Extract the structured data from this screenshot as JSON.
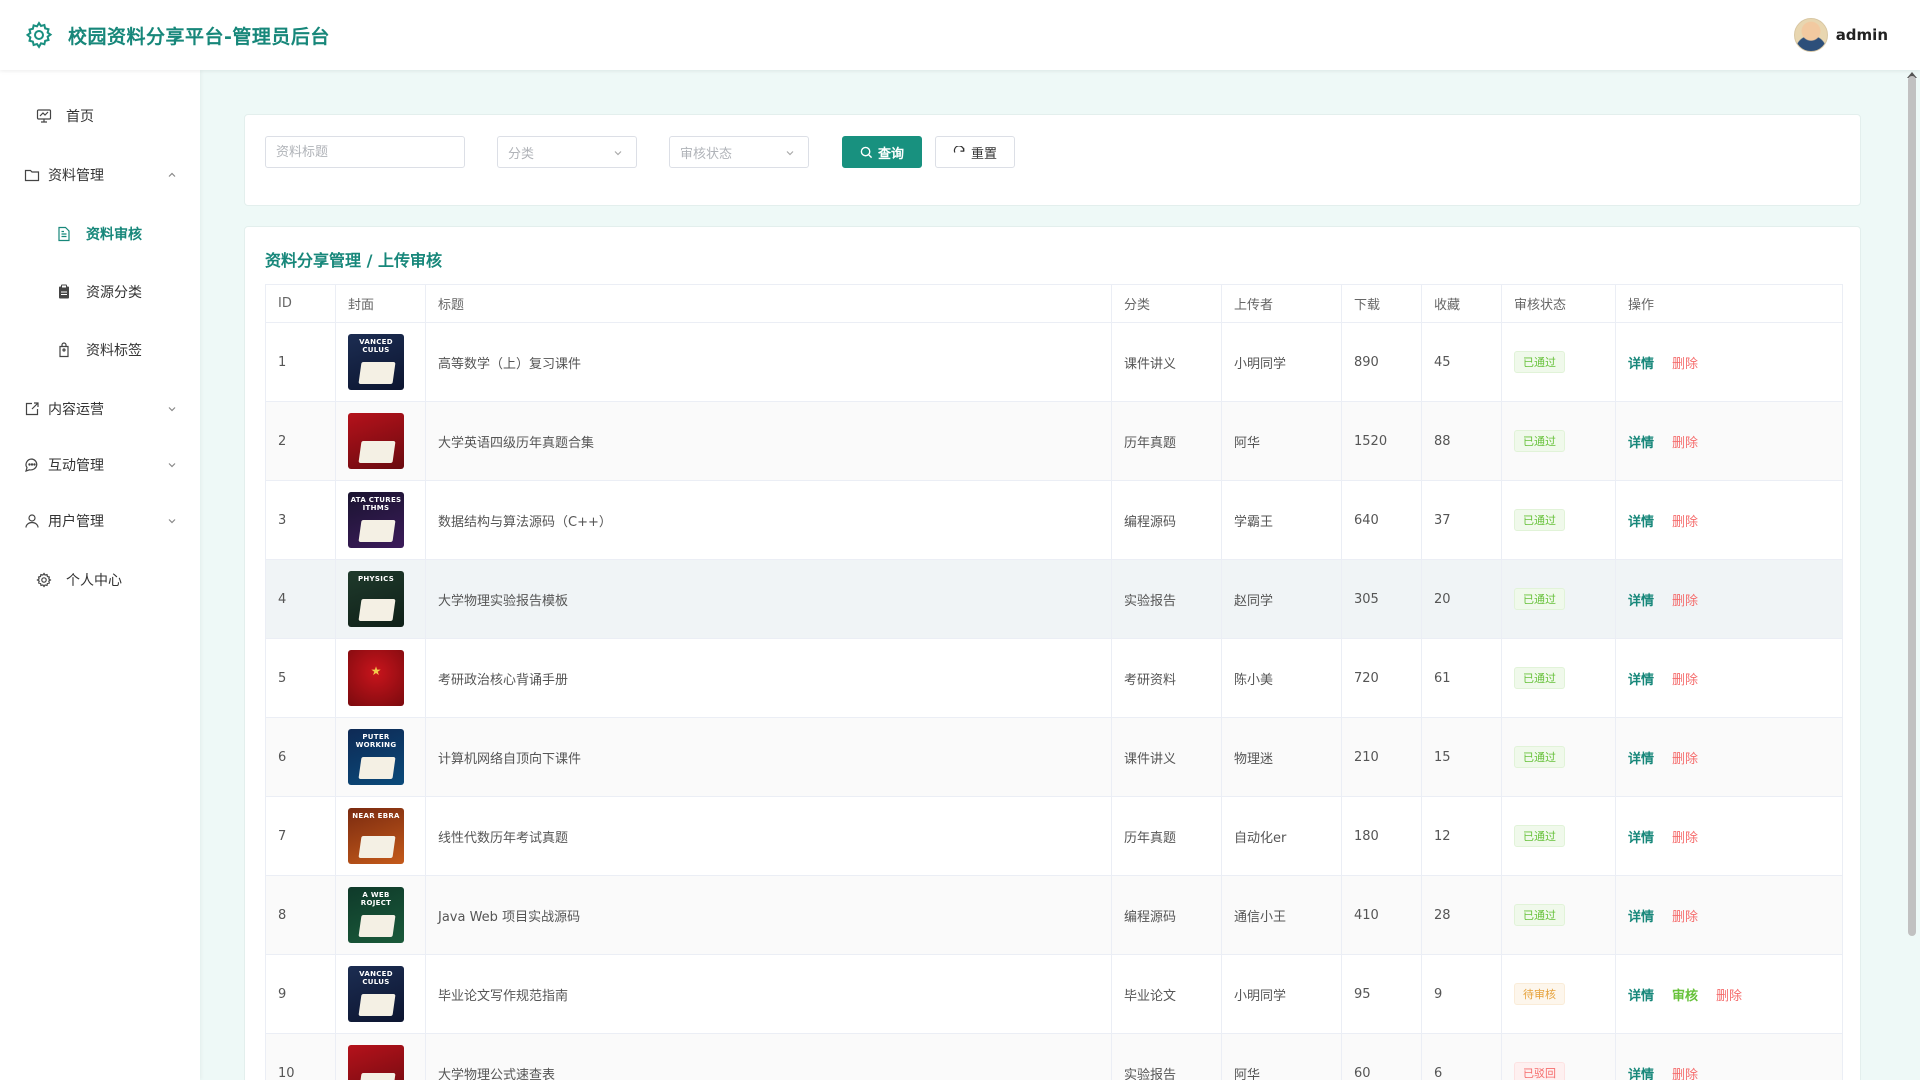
{
  "header": {
    "title": "校园资料分享平台-管理员后台",
    "username": "admin"
  },
  "sidebar": {
    "items": [
      {
        "label": "首页",
        "icon": "monitor-icon"
      },
      {
        "label": "资料管理",
        "icon": "folder-icon",
        "expanded": true
      },
      {
        "label": "资料审核",
        "icon": "document-icon",
        "active": true
      },
      {
        "label": "资源分类",
        "icon": "clipboard-icon"
      },
      {
        "label": "资料标签",
        "icon": "tag-icon"
      },
      {
        "label": "内容运营",
        "icon": "edit-icon"
      },
      {
        "label": "互动管理",
        "icon": "chat-icon"
      },
      {
        "label": "用户管理",
        "icon": "user-icon"
      },
      {
        "label": "个人中心",
        "icon": "gear-icon"
      }
    ]
  },
  "filters": {
    "title_placeholder": "资料标题",
    "category_placeholder": "分类",
    "status_placeholder": "审核状态",
    "search_label": "查询",
    "reset_label": "重置"
  },
  "table": {
    "section_title": "资料分享管理 / 上传审核",
    "columns": [
      "ID",
      "封面",
      "标题",
      "分类",
      "上传者",
      "下载",
      "收藏",
      "审核状态",
      "操作"
    ],
    "actions": {
      "detail": "详情",
      "review": "审核",
      "delete": "删除"
    },
    "rows": [
      {
        "id": "1",
        "title": "高等数学（上）复习课件",
        "category": "课件讲义",
        "uploader": "小明同学",
        "downloads": "890",
        "favorites": "45",
        "status": "已通过",
        "status_kind": "ok",
        "cover_caption": "VANCED CULUS"
      },
      {
        "id": "2",
        "title": "大学英语四级历年真题合集",
        "category": "历年真题",
        "uploader": "阿华",
        "downloads": "1520",
        "favorites": "88",
        "status": "已通过",
        "status_kind": "ok",
        "cover_caption": ""
      },
      {
        "id": "3",
        "title": "数据结构与算法源码（C++）",
        "category": "编程源码",
        "uploader": "学霸王",
        "downloads": "640",
        "favorites": "37",
        "status": "已通过",
        "status_kind": "ok",
        "cover_caption": "ATA CTURES ITHMS"
      },
      {
        "id": "4",
        "title": "大学物理实验报告模板",
        "category": "实验报告",
        "uploader": "赵同学",
        "downloads": "305",
        "favorites": "20",
        "status": "已通过",
        "status_kind": "ok",
        "cover_caption": "PHYSICS"
      },
      {
        "id": "5",
        "title": "考研政治核心背诵手册",
        "category": "考研资料",
        "uploader": "陈小美",
        "downloads": "720",
        "favorites": "61",
        "status": "已通过",
        "status_kind": "ok",
        "cover_caption": ""
      },
      {
        "id": "6",
        "title": "计算机网络自顶向下课件",
        "category": "课件讲义",
        "uploader": "物理迷",
        "downloads": "210",
        "favorites": "15",
        "status": "已通过",
        "status_kind": "ok",
        "cover_caption": "PUTER WORKING"
      },
      {
        "id": "7",
        "title": "线性代数历年考试真题",
        "category": "历年真题",
        "uploader": "自动化er",
        "downloads": "180",
        "favorites": "12",
        "status": "已通过",
        "status_kind": "ok",
        "cover_caption": "NEAR EBRA"
      },
      {
        "id": "8",
        "title": "Java Web 项目实战源码",
        "category": "编程源码",
        "uploader": "通信小王",
        "downloads": "410",
        "favorites": "28",
        "status": "已通过",
        "status_kind": "ok",
        "cover_caption": "A WEB ROJECT"
      },
      {
        "id": "9",
        "title": "毕业论文写作规范指南",
        "category": "毕业论文",
        "uploader": "小明同学",
        "downloads": "95",
        "favorites": "9",
        "status": "待审核",
        "status_kind": "pending",
        "cover_caption": "VANCED CULUS"
      },
      {
        "id": "10",
        "title": "大学物理公式速查表",
        "category": "实验报告",
        "uploader": "阿华",
        "downloads": "60",
        "favorites": "6",
        "status": "已驳回",
        "status_kind": "rejected",
        "cover_caption": ""
      }
    ]
  },
  "colors": {
    "accent": "#17877a",
    "success": "#67c23a",
    "warning": "#e6a23c",
    "danger": "#f56c6c"
  }
}
